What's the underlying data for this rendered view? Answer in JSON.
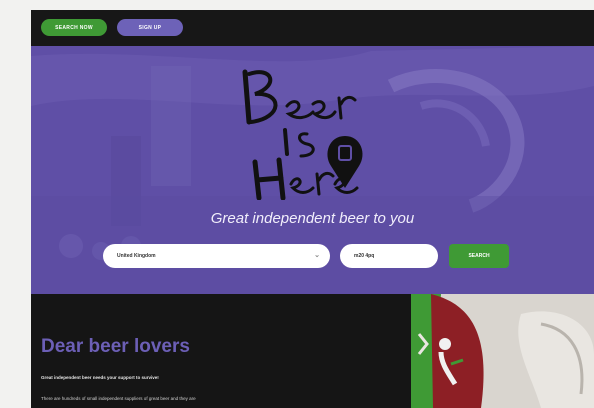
{
  "topbar": {
    "btn_green": "SEARCH NOW",
    "btn_purple": "SIGN UP"
  },
  "hero": {
    "tagline": "Great independent beer to you",
    "country_value": "United Kingdom",
    "postcode_value": "m20 4pq",
    "search_label": "SEARCH"
  },
  "intro": {
    "title": "Dear beer lovers",
    "lead": "Great independent beer needs your support to survive!",
    "body": "There are hundreds of small independent suppliers of great beer and they are"
  },
  "colors": {
    "brand_purple": "#6d62b8",
    "brand_green": "#3f9a35",
    "dark": "#151515"
  }
}
